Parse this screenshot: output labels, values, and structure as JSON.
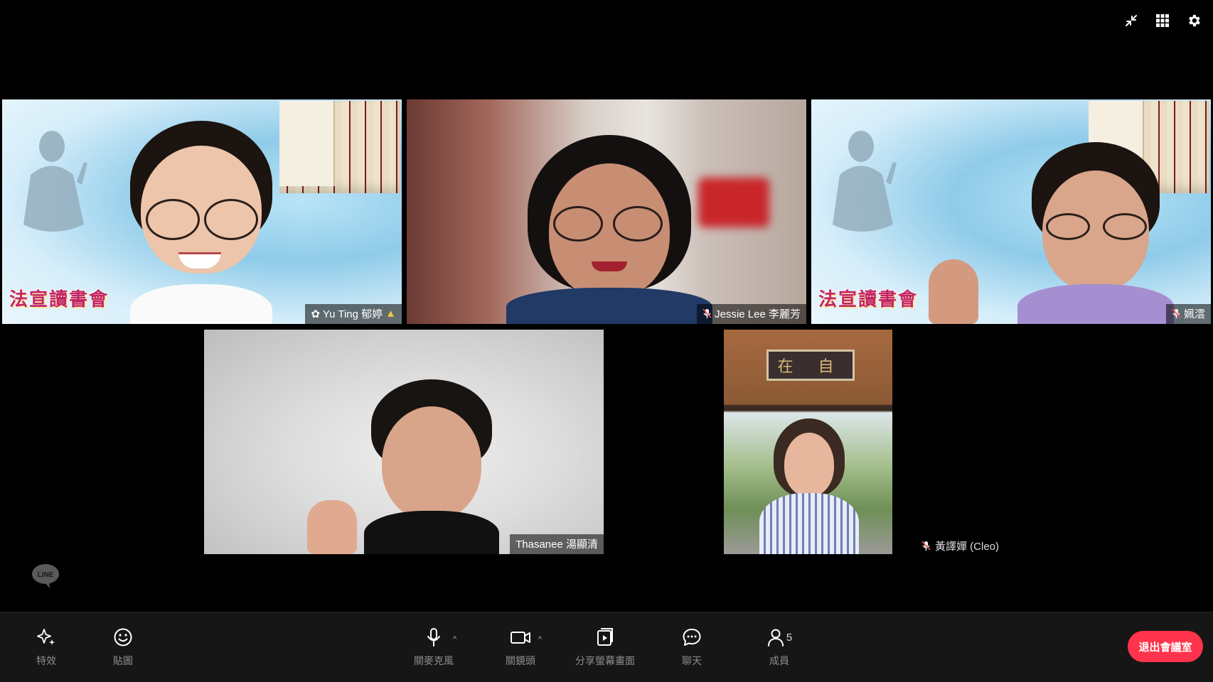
{
  "top_controls": {
    "collapse_icon": "collapse-icon",
    "grid_icon": "grid-view-icon",
    "settings_icon": "gear-icon"
  },
  "participants": [
    {
      "name": "Yu Ting 郁婷",
      "background_text": "法宣讀書會",
      "name_prefix_icon": "sparkle-emoji",
      "name_suffix_icon": "praying-emoji"
    },
    {
      "name": "Jessie Lee 李麗芳",
      "muted": true
    },
    {
      "name": "姵澐",
      "background_text": "法宣讀書會",
      "muted": true
    },
    {
      "name": "Thasanee 湯顯清"
    },
    {
      "name": "黃譯嬋 (Cleo)",
      "muted": true,
      "sign_text": "在 自"
    }
  ],
  "watermark": {
    "label": "LINE"
  },
  "toolbar": {
    "effects_label": "特效",
    "stickers_label": "貼圖",
    "mic_label": "關麥克風",
    "camera_label": "關鏡頭",
    "share_label": "分享螢幕畫面",
    "chat_label": "聊天",
    "members_label": "成員",
    "members_count": "5",
    "leave_label": "退出會議室"
  },
  "colors": {
    "leave_button": "#ff334b",
    "toolbar_bg": "#161616",
    "banner_text": "#c2266a"
  }
}
